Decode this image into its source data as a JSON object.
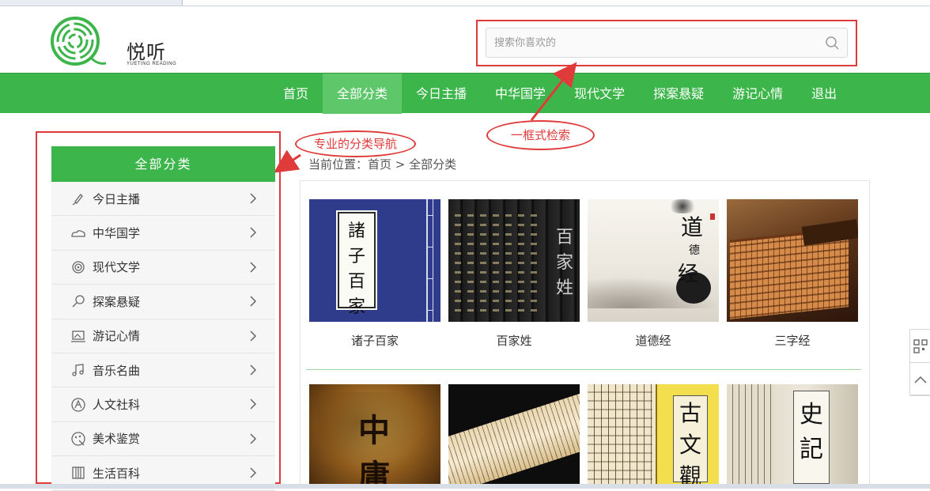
{
  "logo": {
    "name": "悦听",
    "subtitle": "YUETING READING"
  },
  "search": {
    "placeholder": "搜索你喜欢的"
  },
  "nav": {
    "items": [
      {
        "label": "首页"
      },
      {
        "label": "全部分类",
        "active": true
      },
      {
        "label": "今日主播"
      },
      {
        "label": "中华国学"
      },
      {
        "label": "现代文学"
      },
      {
        "label": "探案悬疑"
      },
      {
        "label": "游记心情"
      },
      {
        "label": "退出"
      }
    ]
  },
  "annotations": {
    "search_note": "一框式检索",
    "nav_note": "专业的分类导航"
  },
  "sidebar": {
    "title": "全部分类",
    "items": [
      {
        "label": "今日主播",
        "icon": "microphone-icon"
      },
      {
        "label": "中华国学",
        "icon": "cloud-icon"
      },
      {
        "label": "现代文学",
        "icon": "fingerprint-icon"
      },
      {
        "label": "探案悬疑",
        "icon": "magnifier-icon"
      },
      {
        "label": "游记心情",
        "icon": "landscape-icon"
      },
      {
        "label": "音乐名曲",
        "icon": "music-note-icon"
      },
      {
        "label": "人文社科",
        "icon": "compass-icon"
      },
      {
        "label": "美术鉴赏",
        "icon": "palette-icon"
      },
      {
        "label": "生活百科",
        "icon": "book-icon"
      }
    ]
  },
  "breadcrumb": {
    "text": "当前位置：首页 > 全部分类"
  },
  "books_row1": [
    {
      "title": "诸子百家",
      "cover_text": [
        "諸",
        "子",
        "百",
        "家"
      ]
    },
    {
      "title": "百家姓",
      "cover_text": [
        "百",
        "家",
        "姓"
      ]
    },
    {
      "title": "道德经",
      "cover_text": [
        "道",
        "德",
        "经"
      ]
    },
    {
      "title": "三字经"
    }
  ],
  "books_row2": [
    {
      "cover_text": [
        "中",
        "庸"
      ]
    },
    {},
    {
      "cover_text": [
        "古",
        "文",
        "觀"
      ]
    },
    {
      "cover_text": [
        "史",
        "記"
      ]
    }
  ],
  "colors": {
    "brand_green": "#3cb54a",
    "annotation_red": "#e03b3b"
  }
}
